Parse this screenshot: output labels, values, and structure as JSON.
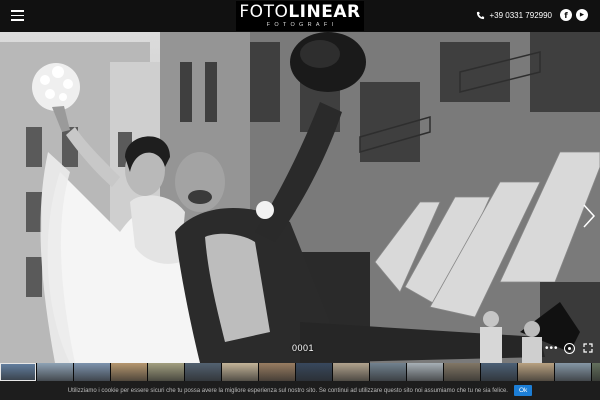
{
  "header": {
    "logo_main_thin": "FOTO",
    "logo_main_bold": "LINEAR",
    "logo_sub": "FOTOGRAFI",
    "phone": "+39 0331 792990",
    "social": [
      {
        "icon": "facebook-icon",
        "glyph": "f"
      },
      {
        "icon": "youtube-icon",
        "glyph": "▶"
      }
    ]
  },
  "slideshow": {
    "counter": "0001",
    "controls": {
      "dots": "•••"
    }
  },
  "thumbnails": {
    "colors": [
      "#6f8fb4",
      "#9db3c8",
      "#8aa3c0",
      "#c9a77a",
      "#b3b08d",
      "#5b6b7c",
      "#d8c7a8",
      "#a8896b",
      "#3d4f66",
      "#c4b49c",
      "#7d8f9e",
      "#b8c2c9",
      "#8f8370",
      "#546a82",
      "#ccb28e",
      "#93a7b7",
      "#6d7b66"
    ]
  },
  "cookie_bar": {
    "text": "Utilizziamo i cookie per essere sicuri che tu possa avere la migliore esperienza sul nostro sito. Se continui ad utilizzare questo sito noi assumiamo che tu ne sia felice.",
    "ok_label": "Ok",
    "ok_color": "#1c7ed6"
  }
}
